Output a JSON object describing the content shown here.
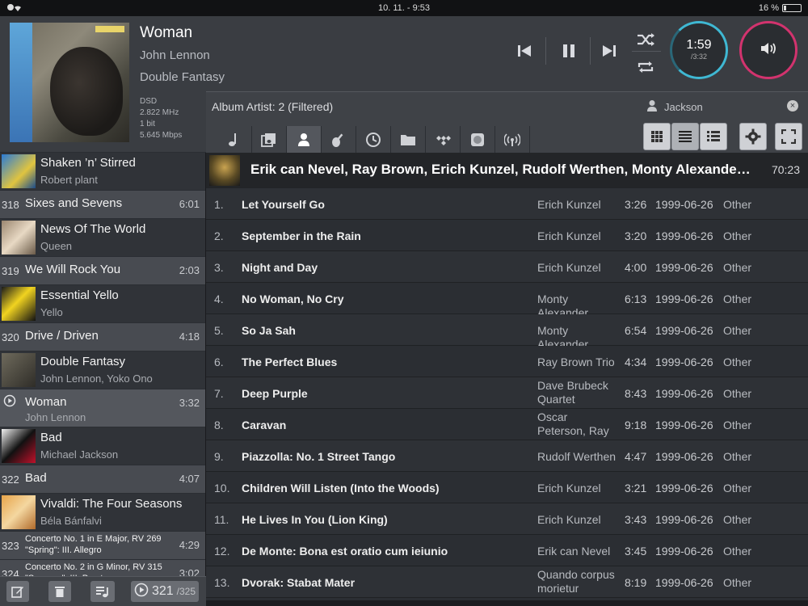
{
  "status": {
    "time": "10. 11. - 9:53",
    "battery": "16 %",
    "battery_level": 0.16
  },
  "now_playing": {
    "title": "Woman",
    "artist": "John Lennon",
    "album": "Double Fantasy",
    "format": "DSD",
    "rate": "2.822 MHz",
    "bits": "1 bit",
    "bitrate": "5.645 Mbps",
    "cover_text": "Double Fantasy",
    "cover_icon": "album-cover-art",
    "elapsed": "1:59",
    "total": "/3:32",
    "progress": 0.56
  },
  "transport": {
    "prev_icon": "skip-previous-icon",
    "pause_icon": "pause-icon",
    "next_icon": "skip-next-icon",
    "shuffle_icon": "shuffle-icon",
    "repeat_icon": "repeat-icon",
    "volume_icon": "volume-icon"
  },
  "colors": {
    "time_ring": "#3fb8d3",
    "volume_ring": "#d2336e"
  },
  "browser": {
    "filter_title": "Album Artist: 2 (Filtered)",
    "user_filter": "Jackson",
    "clear_label": "×",
    "tabs": [
      "song-icon",
      "album-icon",
      "artist-icon",
      "genre-icon",
      "recent-icon",
      "folder-icon",
      "tidal-icon",
      "cd-icon",
      "radio-icon"
    ]
  },
  "queue": {
    "items": [
      {
        "type": "album",
        "title": "Shaken ’n’ Stirred",
        "artist": "Robert plant"
      },
      {
        "type": "track",
        "number": "318",
        "title": "Sixes and Sevens",
        "duration": "6:01"
      },
      {
        "type": "album",
        "title": "News Of The World",
        "artist": "Queen"
      },
      {
        "type": "track",
        "number": "319",
        "title": "We Will Rock You",
        "duration": "2:03"
      },
      {
        "type": "album",
        "title": "Essential Yello",
        "artist": "Yello"
      },
      {
        "type": "track",
        "number": "320",
        "title": "Drive / Driven",
        "duration": "4:18"
      },
      {
        "type": "album",
        "title": "Double Fantasy",
        "artist": "John Lennon, Yoko Ono"
      },
      {
        "type": "playing",
        "title": "Woman",
        "artist": "John Lennon",
        "duration": "3:32"
      },
      {
        "type": "album",
        "title": "Bad",
        "artist": "Michael Jackson"
      },
      {
        "type": "track",
        "number": "322",
        "title": "Bad",
        "duration": "4:07"
      },
      {
        "type": "album",
        "title": "Vivaldi: The Four Seasons",
        "artist": "Béla Bánfalvi"
      },
      {
        "type": "track",
        "number": "323",
        "title": "Concerto No. 1 in E Major, RV 269 \"Spring\": III. Allegro",
        "duration": "4:29"
      },
      {
        "type": "track",
        "number": "324",
        "title": "Concerto No. 2 in G Minor, RV 315 \"Summer\": III. Presto",
        "duration": "3:02"
      }
    ],
    "position": "321",
    "count": "/325"
  },
  "album": {
    "title": "Erik can Nevel, Ray Brown, Erich Kunzel, Rudolf Werthen, Monty Alexander, Dav…",
    "duration": "70:23",
    "tracks": [
      {
        "no": "1.",
        "title": "Let Yourself Go",
        "artist": "Erich Kunzel",
        "length": "3:26",
        "date": "1999-06-26",
        "genre": "Other"
      },
      {
        "no": "2.",
        "title": "September in the Rain",
        "artist": "Erich Kunzel",
        "length": "3:20",
        "date": "1999-06-26",
        "genre": "Other"
      },
      {
        "no": "3.",
        "title": "Night and Day",
        "artist": "Erich Kunzel",
        "length": "4:00",
        "date": "1999-06-26",
        "genre": "Other"
      },
      {
        "no": "4.",
        "title": "No Woman, No Cry",
        "artist": "Monty Alexander",
        "length": "6:13",
        "date": "1999-06-26",
        "genre": "Other"
      },
      {
        "no": "5.",
        "title": "So Ja Sah",
        "artist": "Monty Alexander",
        "length": "6:54",
        "date": "1999-06-26",
        "genre": "Other"
      },
      {
        "no": "6.",
        "title": "The Perfect Blues",
        "artist": "Ray Brown Trio",
        "length": "4:34",
        "date": "1999-06-26",
        "genre": "Other"
      },
      {
        "no": "7.",
        "title": "Deep Purple",
        "artist": "Dave Brubeck Quartet",
        "length": "8:43",
        "date": "1999-06-26",
        "genre": "Other"
      },
      {
        "no": "8.",
        "title": "Caravan",
        "artist": "Oscar Peterson, Ray Brown, M…",
        "length": "9:18",
        "date": "1999-06-26",
        "genre": "Other"
      },
      {
        "no": "9.",
        "title": "Piazzolla: No. 1 Street Tango",
        "artist": "Rudolf Werthen",
        "length": "4:47",
        "date": "1999-06-26",
        "genre": "Other"
      },
      {
        "no": "10.",
        "title": "Children Will Listen (Into the Woods)",
        "artist": "Erich Kunzel",
        "length": "3:21",
        "date": "1999-06-26",
        "genre": "Other"
      },
      {
        "no": "11.",
        "title": "He Lives In You (Lion King)",
        "artist": "Erich Kunzel",
        "length": "3:43",
        "date": "1999-06-26",
        "genre": "Other"
      },
      {
        "no": "12.",
        "title": "De Monte: Bona est oratio cum ieiunio",
        "artist": "Erik can Nevel",
        "length": "3:45",
        "date": "1999-06-26",
        "genre": "Other"
      },
      {
        "no": "13.",
        "title": "Dvorak: Stabat Mater",
        "artist": "Quando corpus morietur",
        "length": "8:19",
        "date": "1999-06-26",
        "genre": "Other"
      }
    ]
  }
}
